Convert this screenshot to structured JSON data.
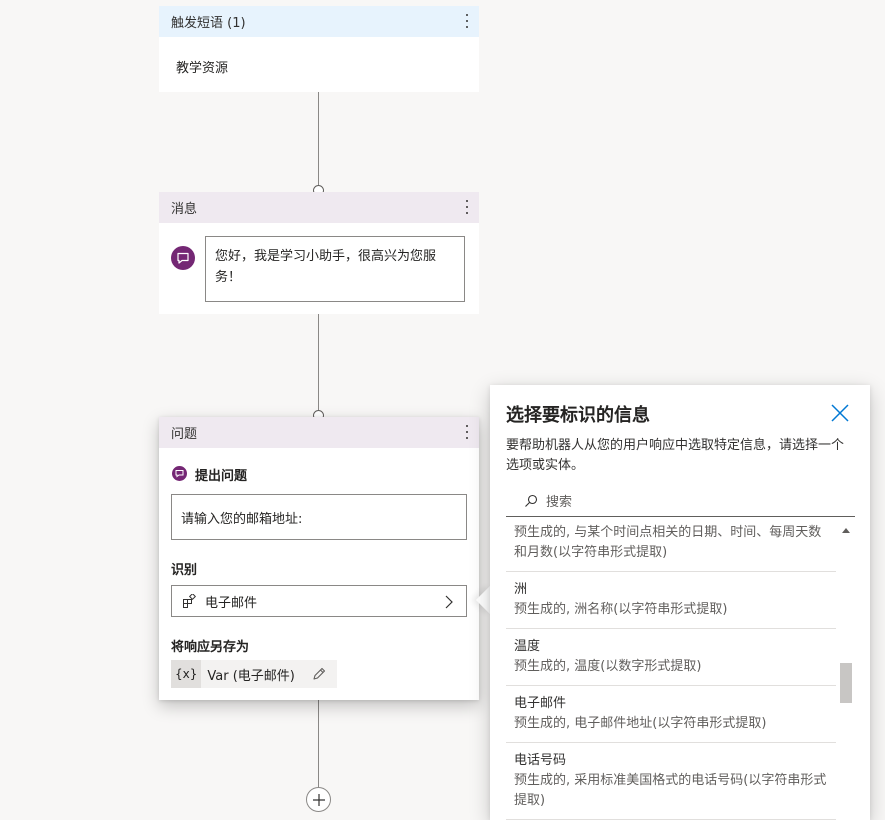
{
  "trigger": {
    "title": "触发短语 (1)",
    "phrase": "教学资源"
  },
  "message": {
    "title": "消息",
    "text": "您好，我是学习小助手，很高兴为您服务！"
  },
  "question": {
    "title": "问题",
    "ask_label": "提出问题",
    "prompt": "请输入您的邮箱地址:",
    "identify_label": "识别",
    "entity": "电子邮件",
    "save_label": "将响应另存为",
    "var_badge": "{x}",
    "var_name": "Var (电子邮件)"
  },
  "panel": {
    "title": "选择要标识的信息",
    "description": "要帮助机器人从您的用户响应中选取特定信息，请选择一个选项或实体。",
    "search_placeholder": "搜索",
    "items": [
      {
        "name": "",
        "desc": "预生成的, 与某个时间点相关的日期、时间、每周天数和月数(以字符串形式提取)"
      },
      {
        "name": "洲",
        "desc": "预生成的, 洲名称(以字符串形式提取)"
      },
      {
        "name": "温度",
        "desc": "预生成的, 温度(以数字形式提取)"
      },
      {
        "name": "电子邮件",
        "desc": "预生成的, 电子邮件地址(以字符串形式提取)"
      },
      {
        "name": "电话号码",
        "desc": "预生成的, 采用标准美国格式的电话号码(以字符串形式提取)"
      }
    ]
  },
  "colors": {
    "accent": "#742774",
    "trigger_header": "#e7f3fd",
    "node_header": "#efe9f0"
  }
}
